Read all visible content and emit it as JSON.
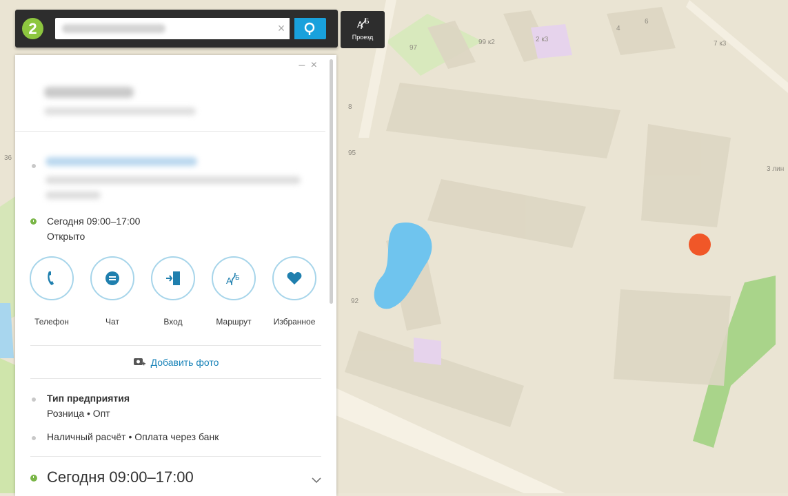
{
  "map": {
    "house_labels": [
      "97",
      "99 к2",
      "2 к3",
      "4",
      "6",
      "7 к3",
      "95",
      "92",
      "3 лин",
      "8",
      "36"
    ],
    "pin_color": "#f04f1f"
  },
  "search": {
    "logo_text": "2",
    "clear_icon": "close-icon",
    "button_icon": "search-icon",
    "route_label": "Проезд"
  },
  "panel": {
    "controls": "– ×",
    "schedule_short": "Сегодня 09:00–17:00",
    "status": "Открыто",
    "actions": [
      {
        "label": "Телефон",
        "icon": "phone-icon"
      },
      {
        "label": "Чат",
        "icon": "chat-icon"
      },
      {
        "label": "Вход",
        "icon": "entrance-icon"
      },
      {
        "label": "Маршрут",
        "icon": "route-icon"
      },
      {
        "label": "Избранное",
        "icon": "heart-icon"
      }
    ],
    "add_photo": "Добавить фото",
    "business_type_title": "Тип предприятия",
    "business_type_value": "Розница • Опт",
    "payment": "Наличный расчёт • Оплата через банк",
    "schedule_large": "Сегодня 09:00–17:00"
  },
  "colors": {
    "accent": "#19a1dc",
    "brand_green": "#8dc63f",
    "status_green": "#7ab648",
    "circle_border": "#a7d5ea",
    "icon_blue": "#1f7fae"
  }
}
